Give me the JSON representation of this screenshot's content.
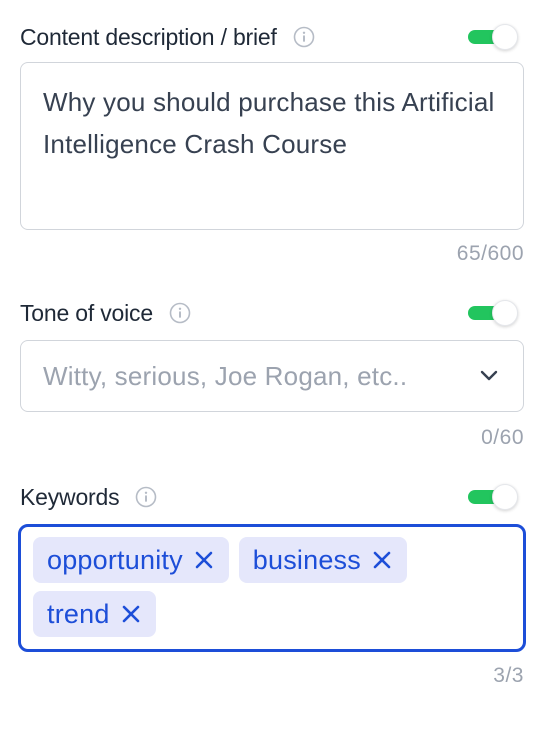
{
  "content_brief": {
    "label": "Content description / brief",
    "info_icon": "info-icon",
    "toggle_on": true,
    "value": "Why you should purchase this Artificial Intelligence Crash Course",
    "counter": "65/600"
  },
  "tone_of_voice": {
    "label": "Tone of voice",
    "info_icon": "info-icon",
    "toggle_on": true,
    "placeholder": "Witty, serious, Joe Rogan, etc..",
    "dropdown_icon": "chevron-down-icon",
    "counter": "0/60"
  },
  "keywords": {
    "label": "Keywords",
    "info_icon": "info-icon",
    "toggle_on": true,
    "chips": [
      {
        "text": "opportunity",
        "remove_icon": "close-icon"
      },
      {
        "text": "business",
        "remove_icon": "close-icon"
      },
      {
        "text": "trend",
        "remove_icon": "close-icon"
      }
    ],
    "counter": "3/3"
  },
  "colors": {
    "toggle_on": "#22c55e",
    "focus_border": "#1d4ed8",
    "chip_bg": "#e5e7fb",
    "chip_text": "#1d4ed8",
    "muted_text": "#9ca3af"
  }
}
